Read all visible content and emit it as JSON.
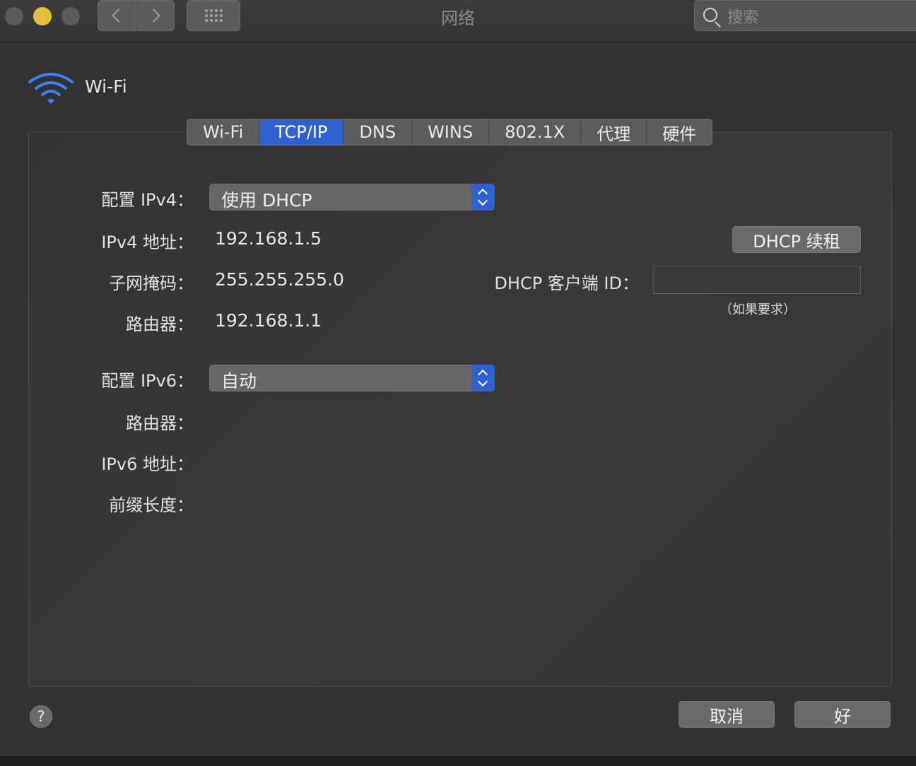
{
  "window": {
    "title": "网络",
    "search_placeholder": "搜索"
  },
  "header": {
    "interface_name": "Wi-Fi",
    "icon": "wifi-icon",
    "accent_color": "#3b82f6"
  },
  "tabs": [
    {
      "label": "Wi-Fi",
      "active": false
    },
    {
      "label": "TCP/IP",
      "active": true
    },
    {
      "label": "DNS",
      "active": false
    },
    {
      "label": "WINS",
      "active": false
    },
    {
      "label": "802.1X",
      "active": false
    },
    {
      "label": "代理",
      "active": false
    },
    {
      "label": "硬件",
      "active": false
    }
  ],
  "ipv4": {
    "config_label": "配置 IPv4：",
    "config_value": "使用 DHCP",
    "address_label": "IPv4 地址：",
    "address_value": "192.168.1.5",
    "subnet_label": "子网掩码：",
    "subnet_value": "255.255.255.0",
    "router_label": "路由器：",
    "router_value": "192.168.1.1",
    "renew_button": "DHCP 续租",
    "client_id_label": "DHCP 客户端 ID：",
    "client_id_value": "",
    "client_id_hint": "（如果要求）"
  },
  "ipv6": {
    "config_label": "配置 IPv6：",
    "config_value": "自动",
    "router_label": "路由器：",
    "address_label": "IPv6 地址：",
    "prefix_label": "前缀长度："
  },
  "footer": {
    "help": "?",
    "cancel_button": "取消",
    "ok_button": "好"
  },
  "colors": {
    "accent": "#2f62d0",
    "window_bg": "#323232",
    "yellow_light": "#e4bf3b"
  }
}
